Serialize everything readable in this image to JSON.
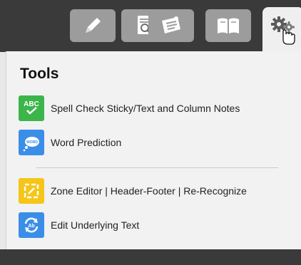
{
  "toolbar": {
    "tabs": [
      {
        "icon": "pencil-icon",
        "active": false
      },
      {
        "icon": "document-search-icon",
        "active": false
      },
      {
        "icon": "sticky-note-icon",
        "active": false
      },
      {
        "icon": "book-icon",
        "active": false
      },
      {
        "icon": "gears-icon",
        "active": true
      }
    ]
  },
  "panel": {
    "title": "Tools",
    "items": [
      {
        "label": "Spell Check Sticky/Text and Column Notes",
        "icon": "spell-check-icon",
        "icon_text": "ABC",
        "color": "#3cb54a"
      },
      {
        "label": "Word Prediction",
        "icon": "word-prediction-icon",
        "icon_text": "WORD",
        "color": "#3b8ee8"
      },
      {
        "label": "Zone Editor | Header-Footer | Re-Recognize",
        "icon": "zone-editor-icon",
        "color": "#f5c518"
      },
      {
        "label": "Edit Underlying Text",
        "icon": "edit-text-icon",
        "icon_text": "Ab",
        "color": "#3b8ee8"
      }
    ]
  },
  "cursor": {
    "icon": "hand-pointer-icon"
  }
}
